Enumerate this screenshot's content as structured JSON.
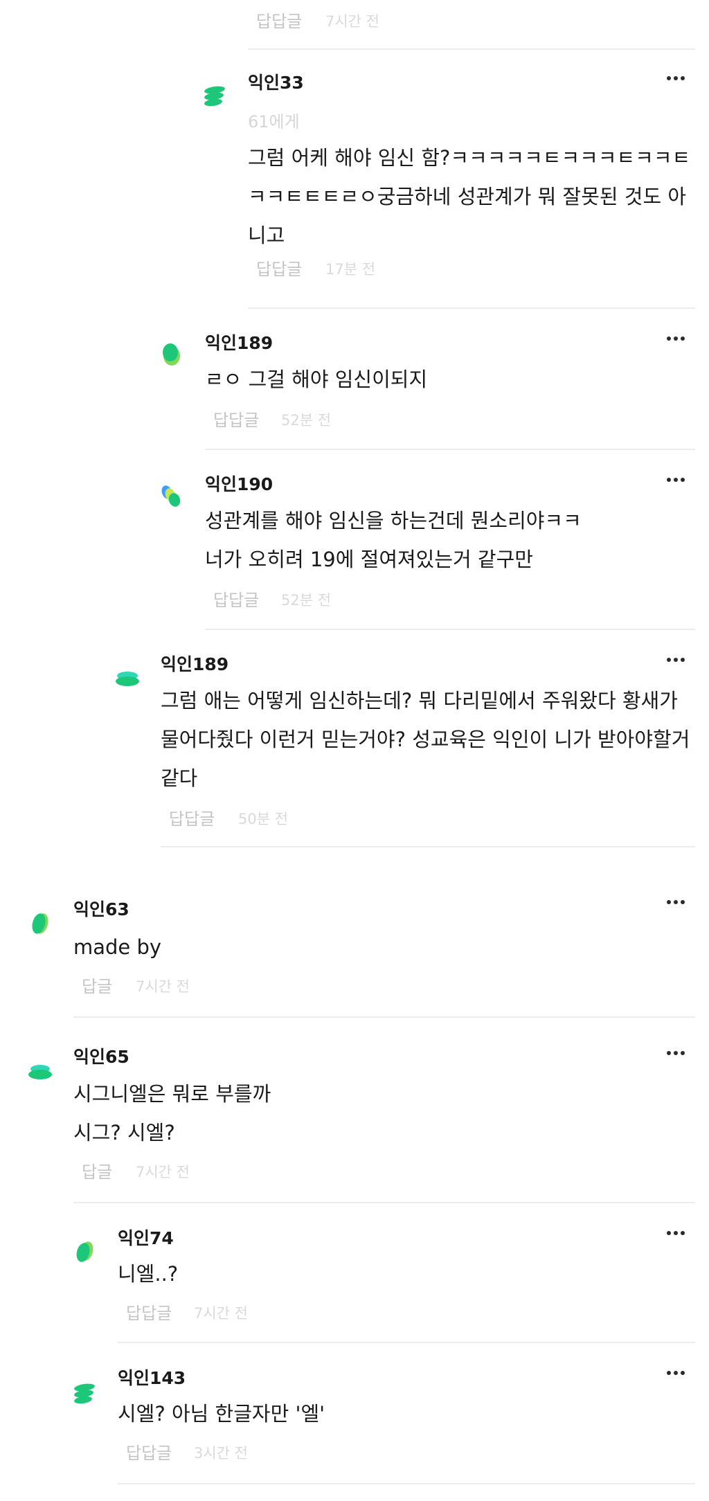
{
  "top_footer": {
    "reply_label": "답답글",
    "time": "7시간 전"
  },
  "comments": [
    {
      "author": "익인33",
      "mention": "61에게",
      "lines": [
        "그럼 어케 해야 임신 함?ㅋㅋㅋㅋㅋㅌㅋㅋㅋㅌㅋㅋㅌ",
        "ㅋㅋㅌㅌㅌㄹㅇ궁금하네 성관계가 뭐 잘못된 것도 아",
        "니고"
      ],
      "reply_label": "답답글",
      "time": "17분 전"
    },
    {
      "author": "익인189",
      "lines": [
        "ㄹㅇ 그걸 해야 임신이되지"
      ],
      "reply_label": "답답글",
      "time": "52분 전"
    },
    {
      "author": "익인190",
      "lines": [
        "성관계를 해야 임신을 하는건데 뭔소리야ㅋㅋ",
        "너가 오히려 19에 절여져있는거 같구만"
      ],
      "reply_label": "답답글",
      "time": "52분 전"
    },
    {
      "author": "익인189",
      "lines": [
        "그럼 애는 어떻게 임신하는데? 뭐 다리밑에서 주워왔다 황새가",
        "물어다줬다 이런거 믿는거야? 성교육은 익인이 니가 받아야할거",
        "같다"
      ],
      "reply_label": "답답글",
      "time": "50분 전"
    },
    {
      "author": "익인63",
      "lines": [
        "made by"
      ],
      "reply_label": "답글",
      "time": "7시간 전"
    },
    {
      "author": "익인65",
      "lines": [
        "시그니엘은 뭐로 부를까",
        "시그? 시엘?"
      ],
      "reply_label": "답글",
      "time": "7시간 전"
    },
    {
      "author": "익인74",
      "lines": [
        "니엘..?"
      ],
      "reply_label": "답답글",
      "time": "7시간 전"
    },
    {
      "author": "익인143",
      "lines": [
        "시엘? 아님 한글자만 '엘'"
      ],
      "reply_label": "답답글",
      "time": "3시간 전"
    }
  ],
  "icons": {
    "more": "more-dots-icon",
    "avatar": "leaf-avatar-icon"
  },
  "colors": {
    "avatar_green": "#1dc77a",
    "avatar_light_green": "#7ed957",
    "avatar_teal": "#2ed8b6",
    "avatar_blue": "#3aa0ff",
    "muted_text": "#c4c4c4",
    "divider": "#ececec"
  }
}
